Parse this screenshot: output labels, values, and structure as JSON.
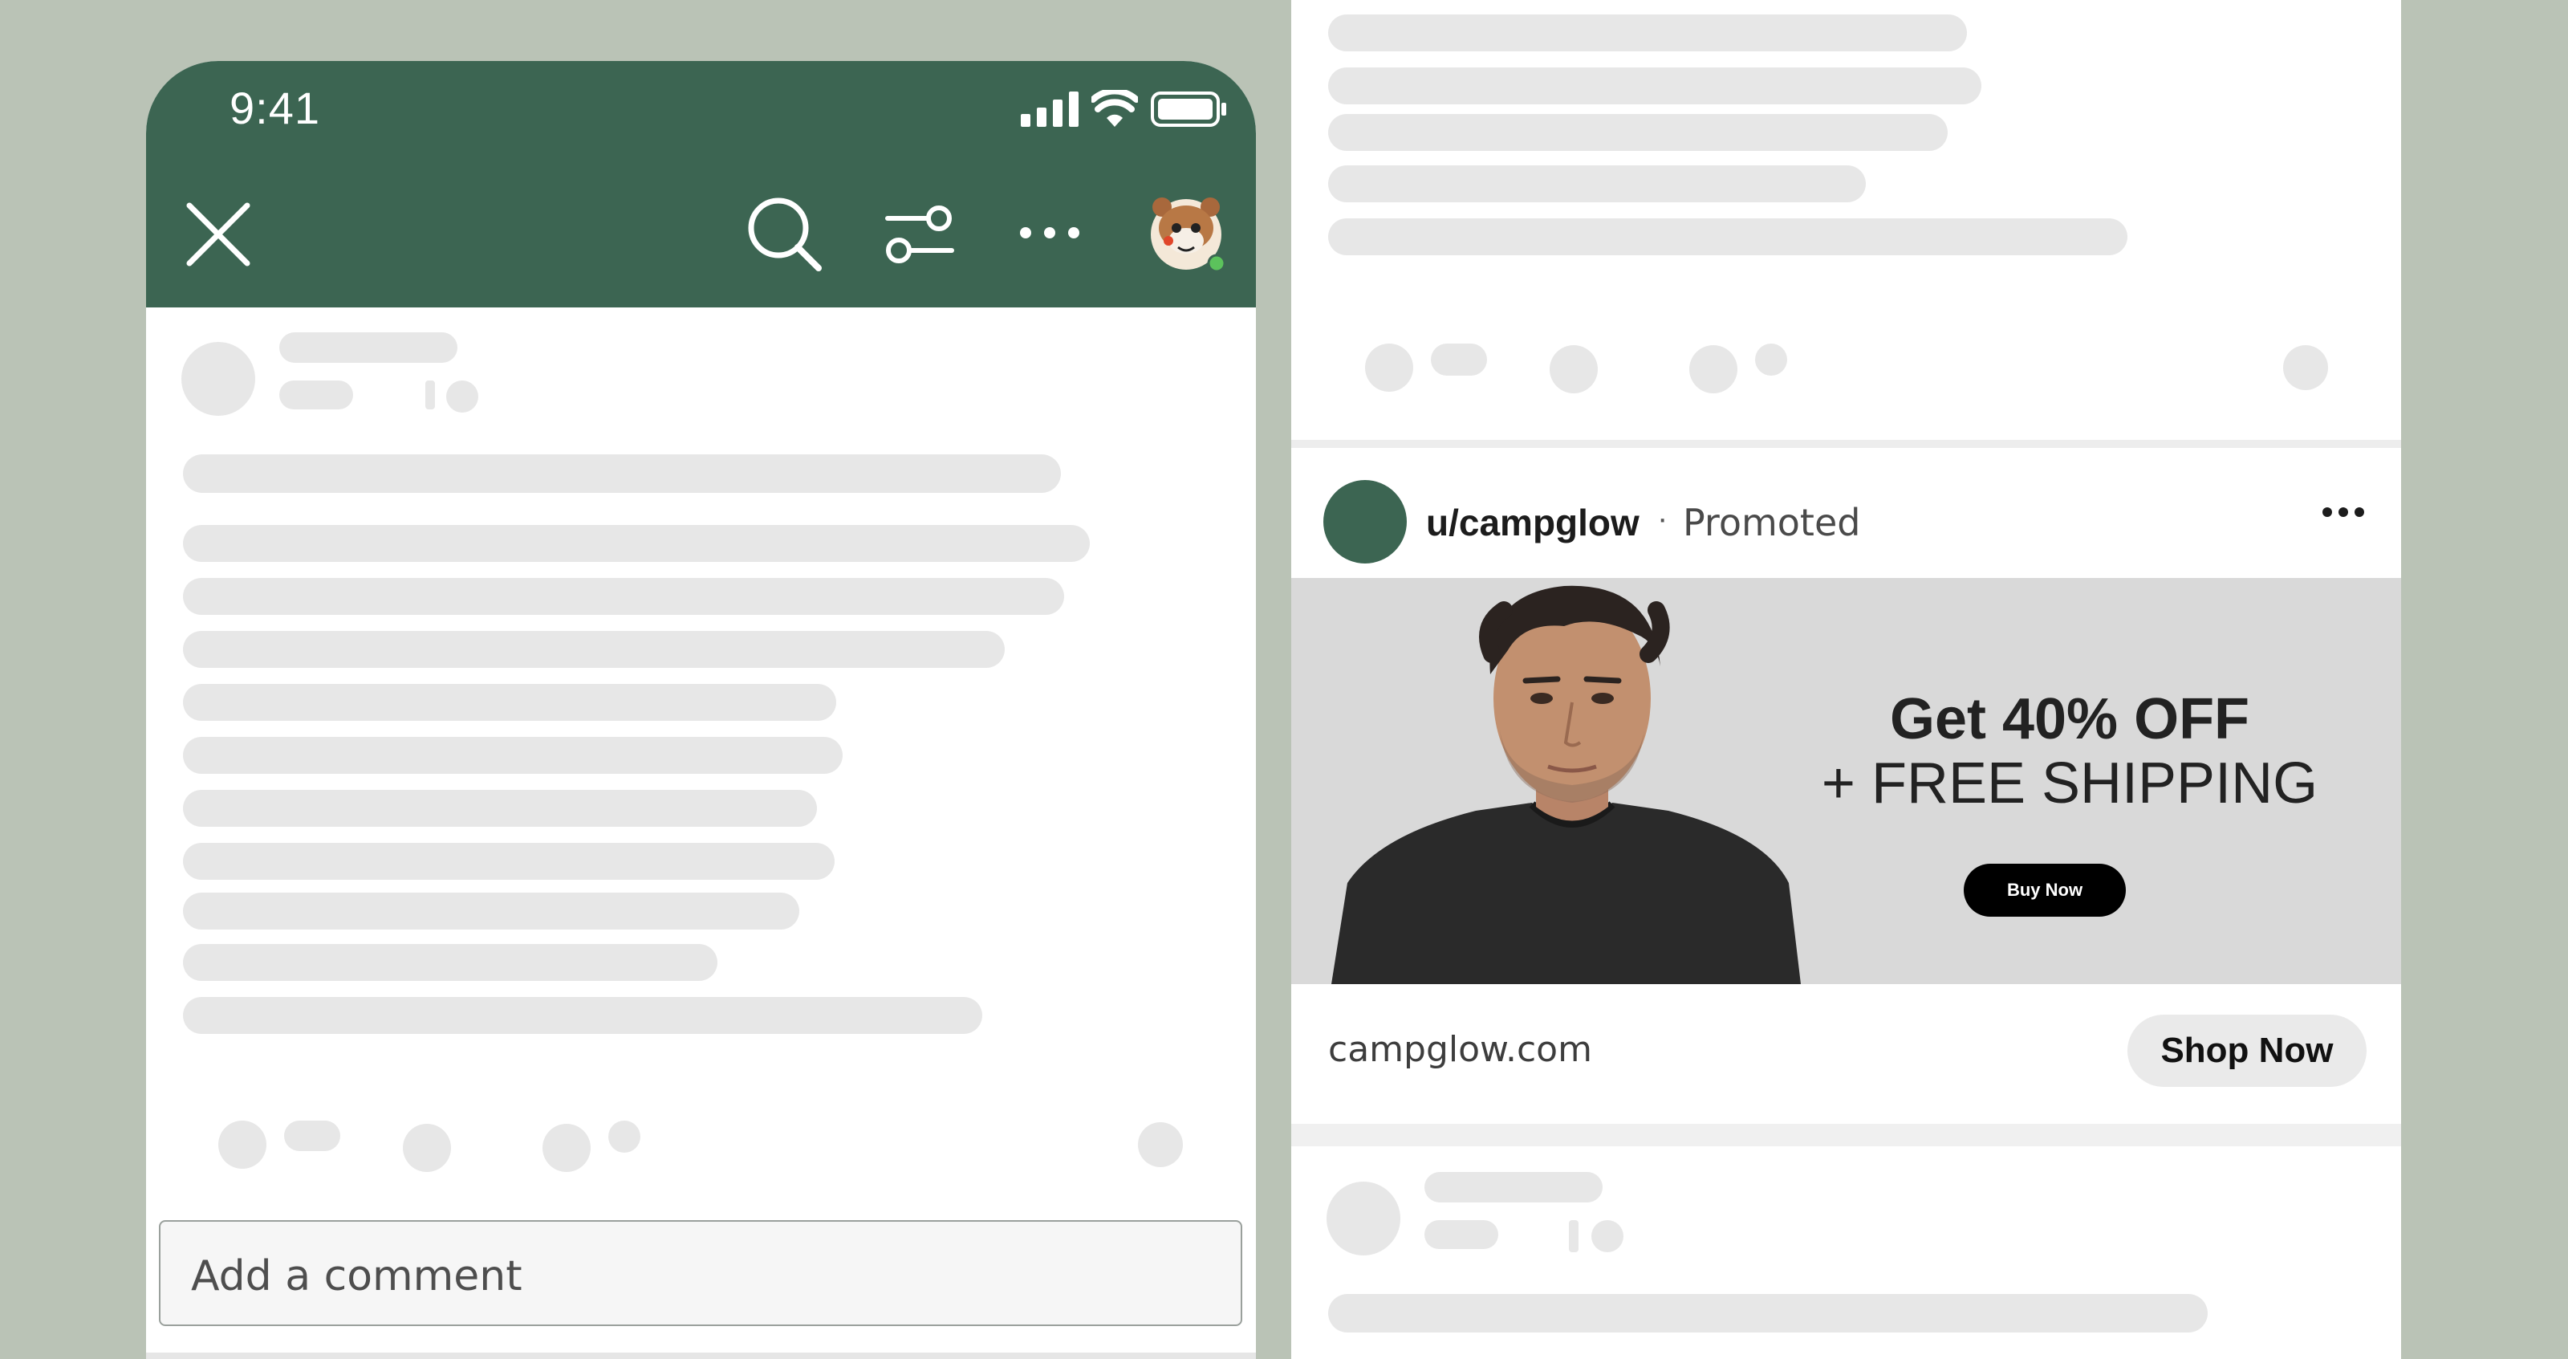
{
  "status_bar": {
    "time": "9:41"
  },
  "toolbar": {
    "close_icon": "close-icon",
    "search_icon": "search-icon",
    "filter_icon": "filter-icon",
    "more_icon": "more-horizontal-icon",
    "avatar_icon": "snoo-bear-avatar"
  },
  "comment": {
    "placeholder": "Add a comment"
  },
  "ad": {
    "username": "u/campglow",
    "separator": "·",
    "label": "Promoted",
    "headline": "Get 40% OFF",
    "subline": "+ FREE SHIPPING",
    "banner_button": "Buy Now",
    "domain": "campglow.com",
    "cta": "Shop Now"
  },
  "colors": {
    "brand_green": "#3c6552",
    "background": "#bac3b6",
    "skeleton": "#e7e7e7"
  }
}
